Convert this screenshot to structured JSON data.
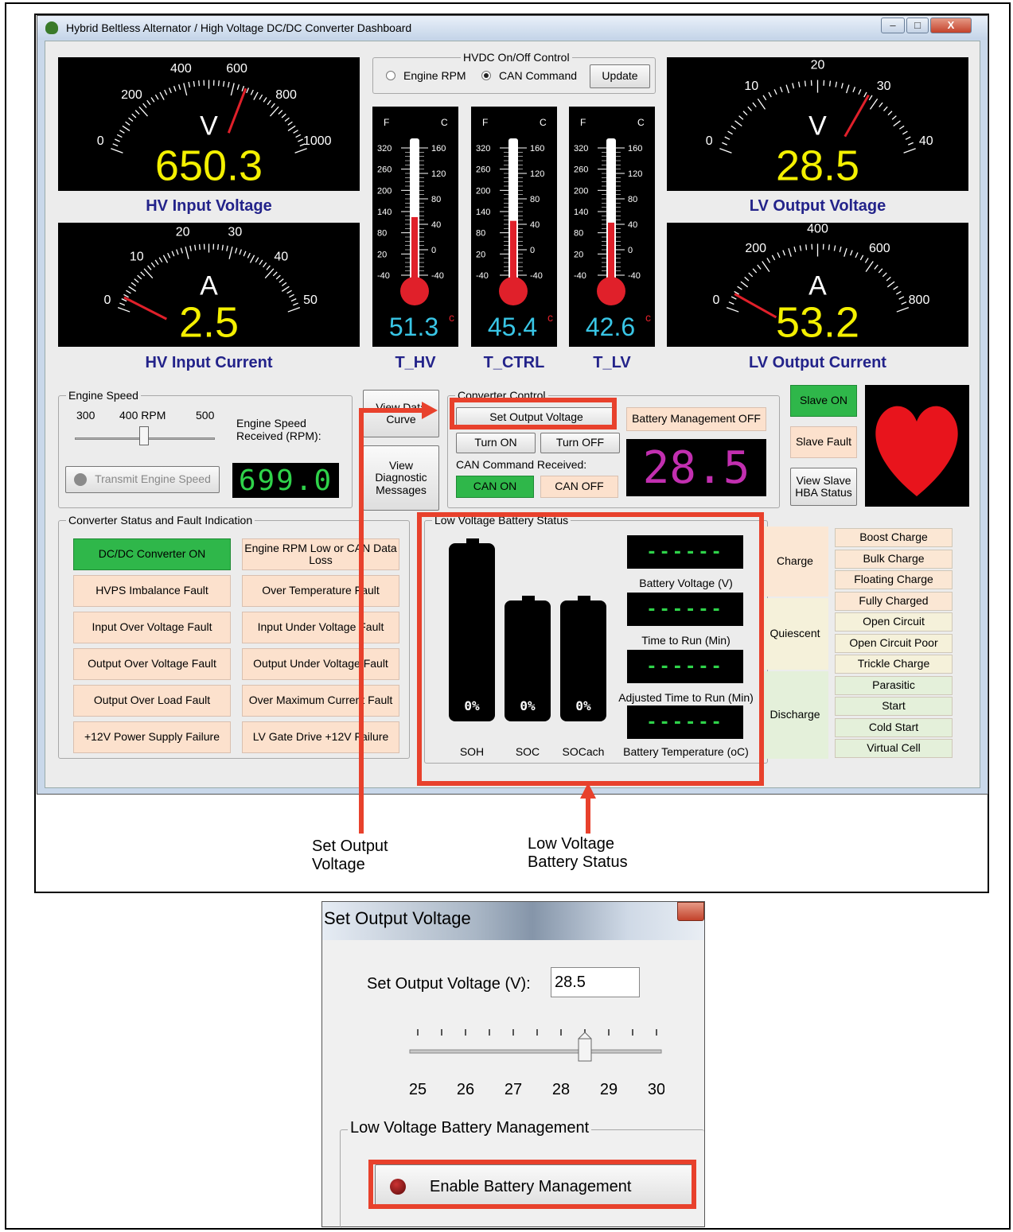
{
  "window": {
    "title": "Hybrid Beltless Alternator / High Voltage DC/DC Converter Dashboard",
    "buttons": [
      "–",
      "□",
      "X"
    ]
  },
  "gauges": {
    "hv_voltage": {
      "label": "HV Input Voltage",
      "unit": "V",
      "value": "650.3",
      "ticks": [
        "0",
        "200",
        "400",
        "600",
        "800",
        "1000"
      ],
      "min": 0,
      "max": 1000,
      "needle": 650.3
    },
    "hv_current": {
      "label": "HV Input Current",
      "unit": "A",
      "value": "2.5",
      "ticks": [
        "0",
        "10",
        "20",
        "30",
        "40",
        "50"
      ],
      "min": 0,
      "max": 50,
      "needle": 2.5
    },
    "lv_voltage": {
      "label": "LV Output Voltage",
      "unit": "V",
      "value": "28.5",
      "ticks": [
        "0",
        "10",
        "20",
        "30",
        "40"
      ],
      "min": 0,
      "max": 40,
      "needle": 28.5
    },
    "lv_current": {
      "label": "LV Output Current",
      "unit": "A",
      "value": "53.2",
      "ticks": [
        "0",
        "200",
        "400",
        "600",
        "800"
      ],
      "min": 0,
      "max": 800,
      "needle": 53.2
    }
  },
  "hvdc_control": {
    "legend": "HVDC On/Off Control",
    "radio1": "Engine RPM",
    "radio2": "CAN Command",
    "update": "Update"
  },
  "thermometers": [
    {
      "label": "T_HV",
      "value": "51.3",
      "unit": "c",
      "level": 51.3
    },
    {
      "label": "T_CTRL",
      "value": "45.4",
      "unit": "c",
      "level": 45.4
    },
    {
      "label": "T_LV",
      "value": "42.6",
      "unit": "c",
      "level": 42.6
    }
  ],
  "thermo_scale": {
    "f_header": "F",
    "c_header": "C",
    "f_ticks": [
      "320",
      "260",
      "200",
      "140",
      "80",
      "20",
      "-40"
    ],
    "c_ticks": [
      "160",
      "120",
      "80",
      "40",
      "0",
      "-40"
    ]
  },
  "engine_speed": {
    "legend": "Engine Speed",
    "ticks": [
      "300",
      "400 RPM",
      "500"
    ],
    "received_label": "Engine Speed Received (RPM):",
    "received_value": "699.0",
    "transmit": "Transmit Engine Speed"
  },
  "view_data_curve": "View Data Curve",
  "view_diag": "View Diagnostic Messages",
  "converter_control": {
    "legend": "Converter Control",
    "set_output": "Set Output Voltage",
    "battery_mgmt": "Battery Management OFF",
    "turn_on": "Turn ON",
    "turn_off": "Turn OFF",
    "can_received": "CAN Command Received:",
    "can_on": "CAN ON",
    "can_off": "CAN OFF",
    "display": "28.5"
  },
  "slave": {
    "on": "Slave ON",
    "fault": "Slave Fault",
    "view": "View Slave HBA Status"
  },
  "status": {
    "legend": "Converter Status and Fault Indication",
    "left": [
      "DC/DC Converter ON",
      "HVPS Imbalance Fault",
      "Input Over Voltage Fault",
      "Output Over Voltage Fault",
      "Output Over Load Fault",
      "+12V Power Supply Failure"
    ],
    "right": [
      "Engine RPM Low or CAN Data Loss",
      "Over Temperature Fault",
      "Input Under Voltage Fault",
      "Output Under Voltage Fault",
      "Over Maximum Current Fault",
      "LV Gate Drive +12V Failure"
    ]
  },
  "battery": {
    "legend": "Low Voltage Battery Status",
    "bars": [
      {
        "label": "SOH",
        "pct": "0%"
      },
      {
        "label": "SOC",
        "pct": "0%"
      },
      {
        "label": "SOCach",
        "pct": "0%"
      }
    ],
    "readouts": [
      {
        "value": "------",
        "label": "Battery Voltage (V)"
      },
      {
        "value": "------",
        "label": "Time to Run (Min)"
      },
      {
        "value": "------",
        "label": "Adjusted Time to Run (Min)"
      },
      {
        "value": "------",
        "label": "Battery Temperature (oC)"
      }
    ]
  },
  "modes": {
    "groups": [
      "Charge",
      "Quiescent",
      "Discharge"
    ],
    "items": [
      "Boost Charge",
      "Bulk Charge",
      "Floating Charge",
      "Fully Charged",
      "Open Circuit",
      "Open Circuit Poor",
      "Trickle Charge",
      "Parasitic",
      "Start",
      "Cold Start",
      "Virtual Cell"
    ]
  },
  "annotations": {
    "set_output": "Set Output Voltage",
    "lv_battery": "Low Voltage Battery Status"
  },
  "dialog": {
    "title": "Set Output Voltage",
    "field_label": "Set Output Voltage (V):",
    "field_value": "28.5",
    "slider_ticks": [
      "25",
      "26",
      "27",
      "28",
      "29",
      "30"
    ],
    "slider_value": 28.5,
    "group_legend": "Low Voltage Battery Management",
    "enable_btn": "Enable Battery Management"
  },
  "colors": {
    "accent_red": "#e8412c",
    "status_green": "#2fb74a",
    "peach": "#fce1cd",
    "gauge_yellow": "#f4f000",
    "thermo_cyan": "#39c6e6",
    "lcd_green": "#2fd34a",
    "lcd_purple": "#c22fb0"
  }
}
